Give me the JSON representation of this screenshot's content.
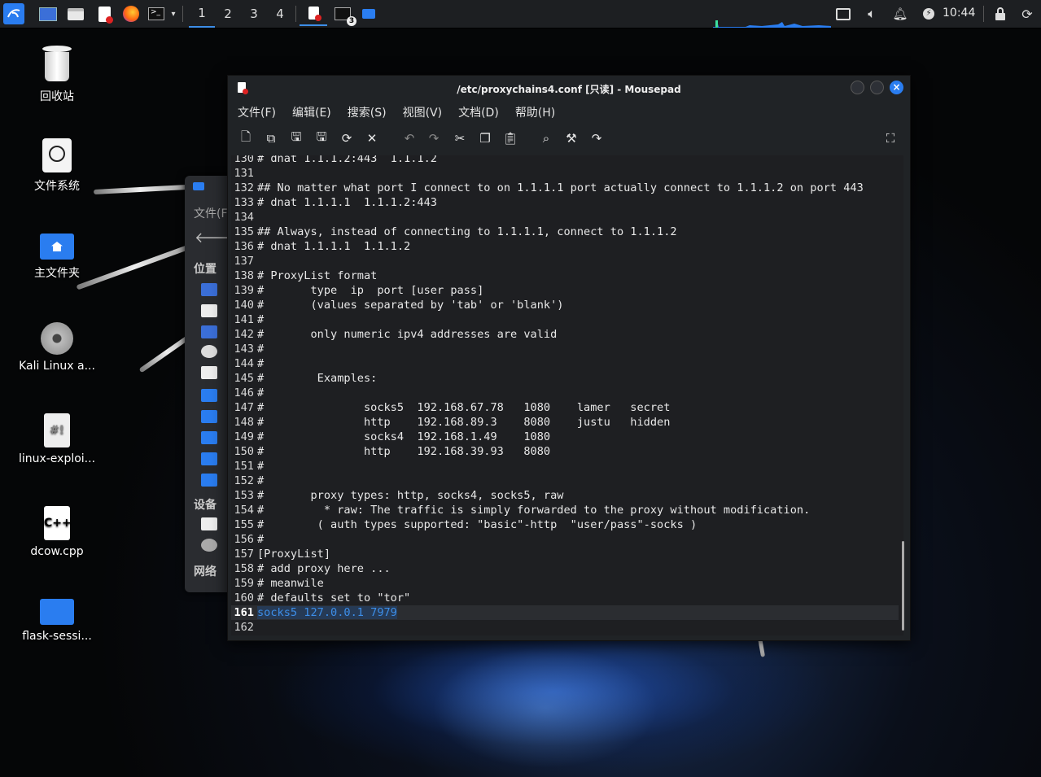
{
  "taskbar": {
    "workspaces": [
      "1",
      "2",
      "3",
      "4"
    ],
    "active_workspace": "1",
    "badge": "3",
    "time": "10:44"
  },
  "desktop": {
    "icons": [
      {
        "label": "回收站",
        "icon": "trash-icon"
      },
      {
        "label": "文件系统",
        "icon": "drive-icon"
      },
      {
        "label": "主文件夹",
        "icon": "home-folder-icon"
      },
      {
        "label": "Kali Linux a...",
        "icon": "disc-icon"
      },
      {
        "label": "linux-exploi...",
        "icon": "script-icon"
      },
      {
        "label": "dcow.cpp",
        "icon": "cpp-file-icon"
      },
      {
        "label": "flask-sessi...",
        "icon": "folder-icon"
      }
    ]
  },
  "file_manager": {
    "menu_partial": "文件(F",
    "places_title": "位置",
    "devices_title": "设备",
    "network_title": "网络"
  },
  "editor": {
    "title": "/etc/proxychains4.conf [只读] - Mousepad",
    "menu": [
      "文件(F)",
      "编辑(E)",
      "搜索(S)",
      "视图(V)",
      "文档(D)",
      "帮助(H)"
    ],
    "lines": [
      {
        "n": "130",
        "t": "# dnat 1.1.1.2:443  1.1.1.2"
      },
      {
        "n": "131",
        "t": ""
      },
      {
        "n": "132",
        "t": "## No matter what port I connect to on 1.1.1.1 port actually connect to 1.1.1.2 on port 443"
      },
      {
        "n": "133",
        "t": "# dnat 1.1.1.1  1.1.1.2:443"
      },
      {
        "n": "134",
        "t": ""
      },
      {
        "n": "135",
        "t": "## Always, instead of connecting to 1.1.1.1, connect to 1.1.1.2"
      },
      {
        "n": "136",
        "t": "# dnat 1.1.1.1  1.1.1.2"
      },
      {
        "n": "137",
        "t": ""
      },
      {
        "n": "138",
        "t": "# ProxyList format"
      },
      {
        "n": "139",
        "t": "#       type  ip  port [user pass]"
      },
      {
        "n": "140",
        "t": "#       (values separated by 'tab' or 'blank')"
      },
      {
        "n": "141",
        "t": "#"
      },
      {
        "n": "142",
        "t": "#       only numeric ipv4 addresses are valid"
      },
      {
        "n": "143",
        "t": "#"
      },
      {
        "n": "144",
        "t": "#"
      },
      {
        "n": "145",
        "t": "#        Examples:"
      },
      {
        "n": "146",
        "t": "#"
      },
      {
        "n": "147",
        "t": "#               socks5  192.168.67.78   1080    lamer   secret"
      },
      {
        "n": "148",
        "t": "#               http    192.168.89.3    8080    justu   hidden"
      },
      {
        "n": "149",
        "t": "#               socks4  192.168.1.49    1080"
      },
      {
        "n": "150",
        "t": "#               http    192.168.39.93   8080"
      },
      {
        "n": "151",
        "t": "#"
      },
      {
        "n": "152",
        "t": "#"
      },
      {
        "n": "153",
        "t": "#       proxy types: http, socks4, socks5, raw"
      },
      {
        "n": "154",
        "t": "#         * raw: The traffic is simply forwarded to the proxy without modification."
      },
      {
        "n": "155",
        "t": "#        ( auth types supported: \"basic\"-http  \"user/pass\"-socks )"
      },
      {
        "n": "156",
        "t": "#"
      },
      {
        "n": "157",
        "t": "[ProxyList]"
      },
      {
        "n": "158",
        "t": "# add proxy here ..."
      },
      {
        "n": "159",
        "t": "# meanwile"
      },
      {
        "n": "160",
        "t": "# defaults set to \"tor\""
      },
      {
        "n": "161",
        "t": "socks5 127.0.0.1 7979"
      },
      {
        "n": "162",
        "t": ""
      }
    ],
    "current_line": "161"
  }
}
